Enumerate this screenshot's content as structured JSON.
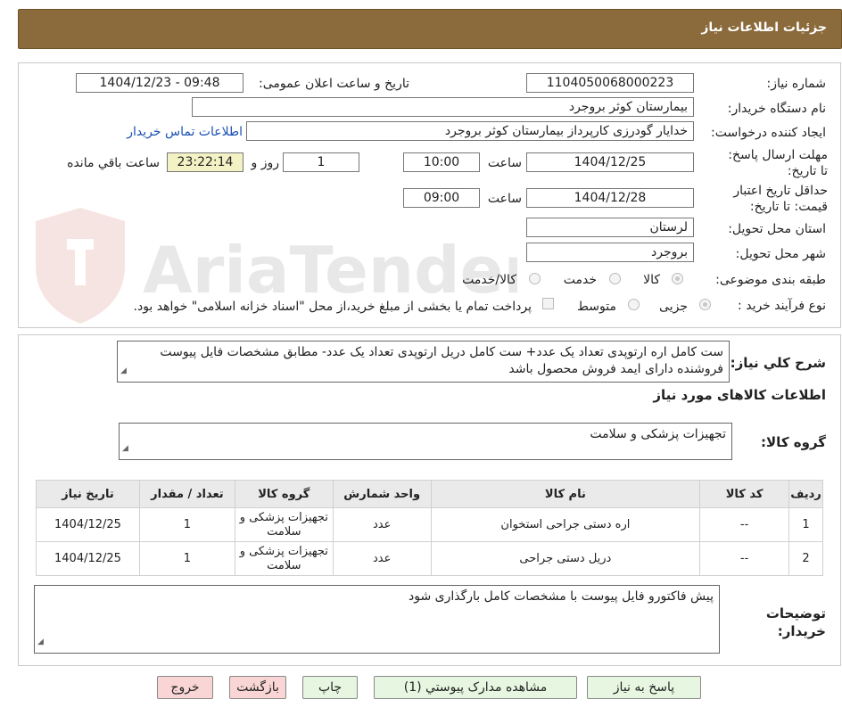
{
  "header": {
    "title": "جزئیات اطلاعات نیاز"
  },
  "watermark": "AriaTender.neT",
  "form": {
    "need_number_label": "شماره نیاز:",
    "need_number": "1104050068000223",
    "announce_label": "تاریخ و ساعت اعلان عمومی:",
    "announce_value": "1404/12/23 - 09:48",
    "buyer_org_label": "نام دستگاه خریدار:",
    "buyer_org": "بیمارستان کوثر بروجرد",
    "requester_label": "ایجاد کننده درخواست:",
    "requester": "خدایار  گودرزی کارپرداز بیمارستان کوثر بروجرد",
    "contact_link": "اطلاعات تماس خریدار",
    "send_deadline_label": "مهلت ارسال پاسخ: تا تاریخ:",
    "send_deadline_date": "1404/12/25",
    "time_label": "ساعت",
    "send_deadline_time": "10:00",
    "days_value": "1",
    "days_label": "روز و",
    "remaining_time": "23:22:14",
    "remaining_label": "ساعت باقي مانده",
    "price_validity_label": "حداقل تاریخ اعتبار قیمت: تا تاریخ:",
    "price_validity_date": "1404/12/28",
    "price_validity_time": "09:00",
    "province_label": "استان محل تحویل:",
    "province": "لرستان",
    "city_label": "شهر محل تحویل:",
    "city": "بروجرد",
    "category_label": "طبقه بندی موضوعی:",
    "category_options": [
      "کالا",
      "خدمت",
      "کالا/خدمت"
    ],
    "category_selected": "کالا",
    "purchase_type_label": "نوع فرآیند خرید :",
    "purchase_options": [
      "جزیی",
      "متوسط"
    ],
    "purchase_selected": "جزیی",
    "payment_note": "پرداخت تمام یا بخشی از مبلغ خرید،از محل \"اسناد خزانه اسلامی\" خواهد بود."
  },
  "description": {
    "label": "شرح کلي نياز:",
    "text": "ست کامل اره ارتوپدی تعداد یک عدد+ ست کامل دریل ارتوپدی تعداد یک عدد- مطابق مشخصات فایل پیوست فروشنده دارای ایمد فروش محصول باشد"
  },
  "goods_section_title": "اطلاعات کالاهای مورد نیاز",
  "goods_group": {
    "label": "گروه کالا:",
    "value": "تجهیزات پزشکی و سلامت"
  },
  "table": {
    "headers": [
      "ردیف",
      "کد کالا",
      "نام کالا",
      "واحد شمارش",
      "گروه کالا",
      "تعداد / مقدار",
      "تاریخ نیاز"
    ],
    "rows": [
      [
        "1",
        "--",
        "اره دستی جراحی استخوان",
        "عدد",
        "تجهیزات پزشکی و سلامت",
        "1",
        "1404/12/25"
      ],
      [
        "2",
        "--",
        "دریل دستی جراحی",
        "عدد",
        "تجهیزات پزشکی و سلامت",
        "1",
        "1404/12/25"
      ]
    ]
  },
  "buyer_notes": {
    "label": "توضیحات خریدار:",
    "text": "پیش فاکتورو فایل پیوست با مشخصات کامل بارگذاری شود"
  },
  "buttons": {
    "reply": "پاسخ به نیاز",
    "attachments": "مشاهده مدارک پیوستي (1)",
    "print": "چاپ",
    "back": "بازگشت",
    "exit": "خروج"
  }
}
